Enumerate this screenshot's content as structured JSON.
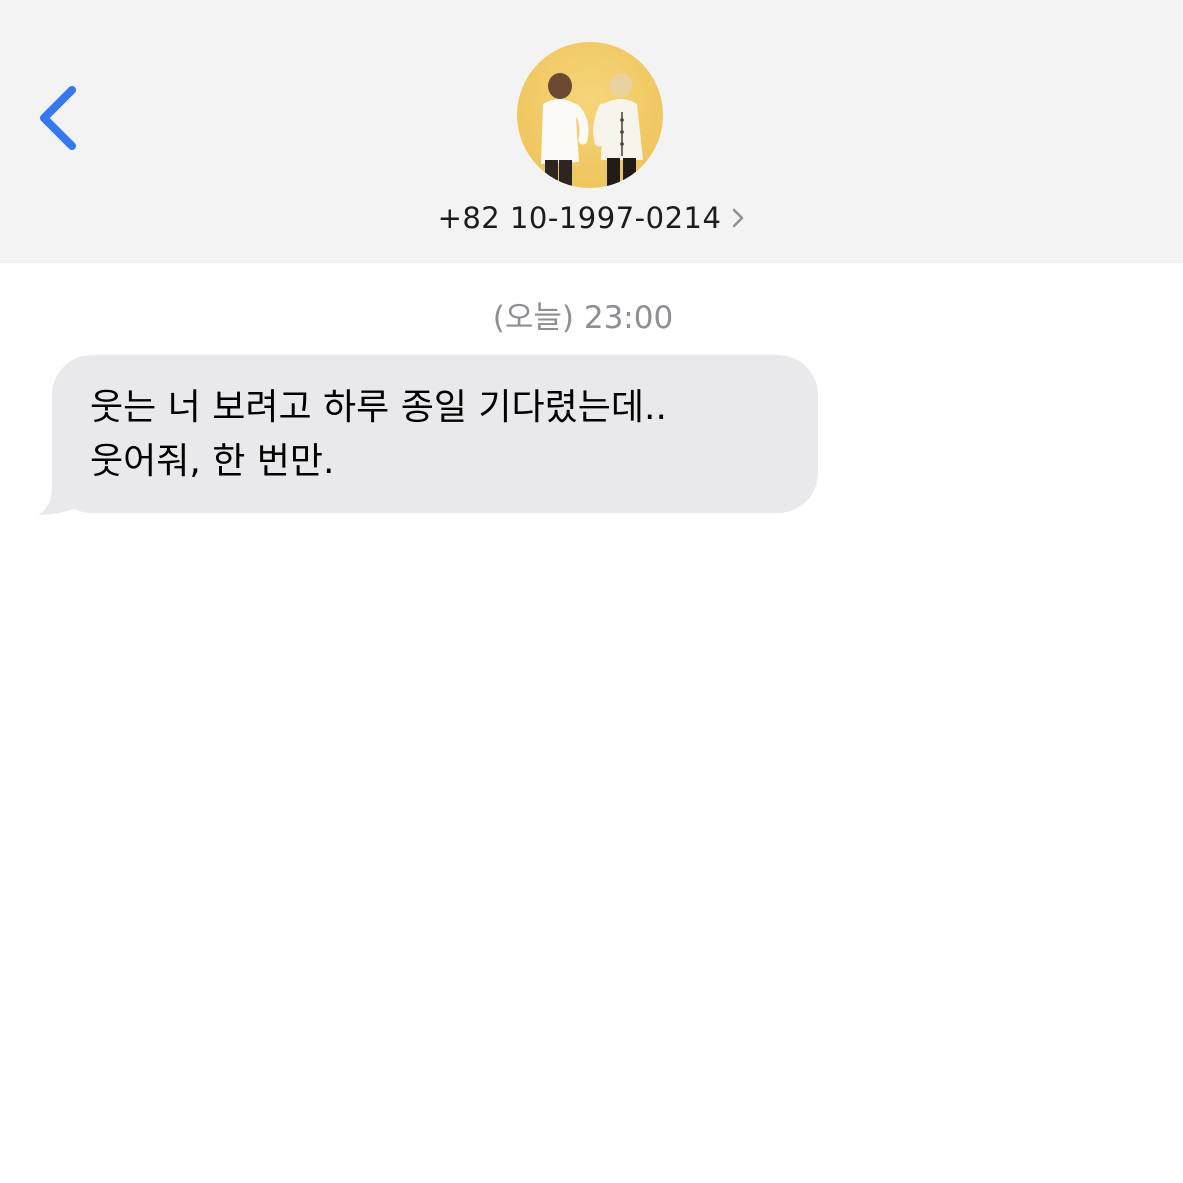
{
  "header": {
    "back_icon": "chevron-left-icon",
    "contact_name": "+82 10-1997-0214",
    "contact_chevron_icon": "chevron-right-icon",
    "avatar": "contact-photo",
    "accent_color": "#3478f6",
    "background_color": "#f3f3f3"
  },
  "conversation": {
    "timestamp": "(오늘) 23:00",
    "messages": [
      {
        "direction": "incoming",
        "lines": [
          "웃는 너 보려고 하루 종일 기다렸는데..",
          "웃어줘, 한 번만."
        ],
        "bubble_color": "#e9e9eb"
      }
    ]
  }
}
